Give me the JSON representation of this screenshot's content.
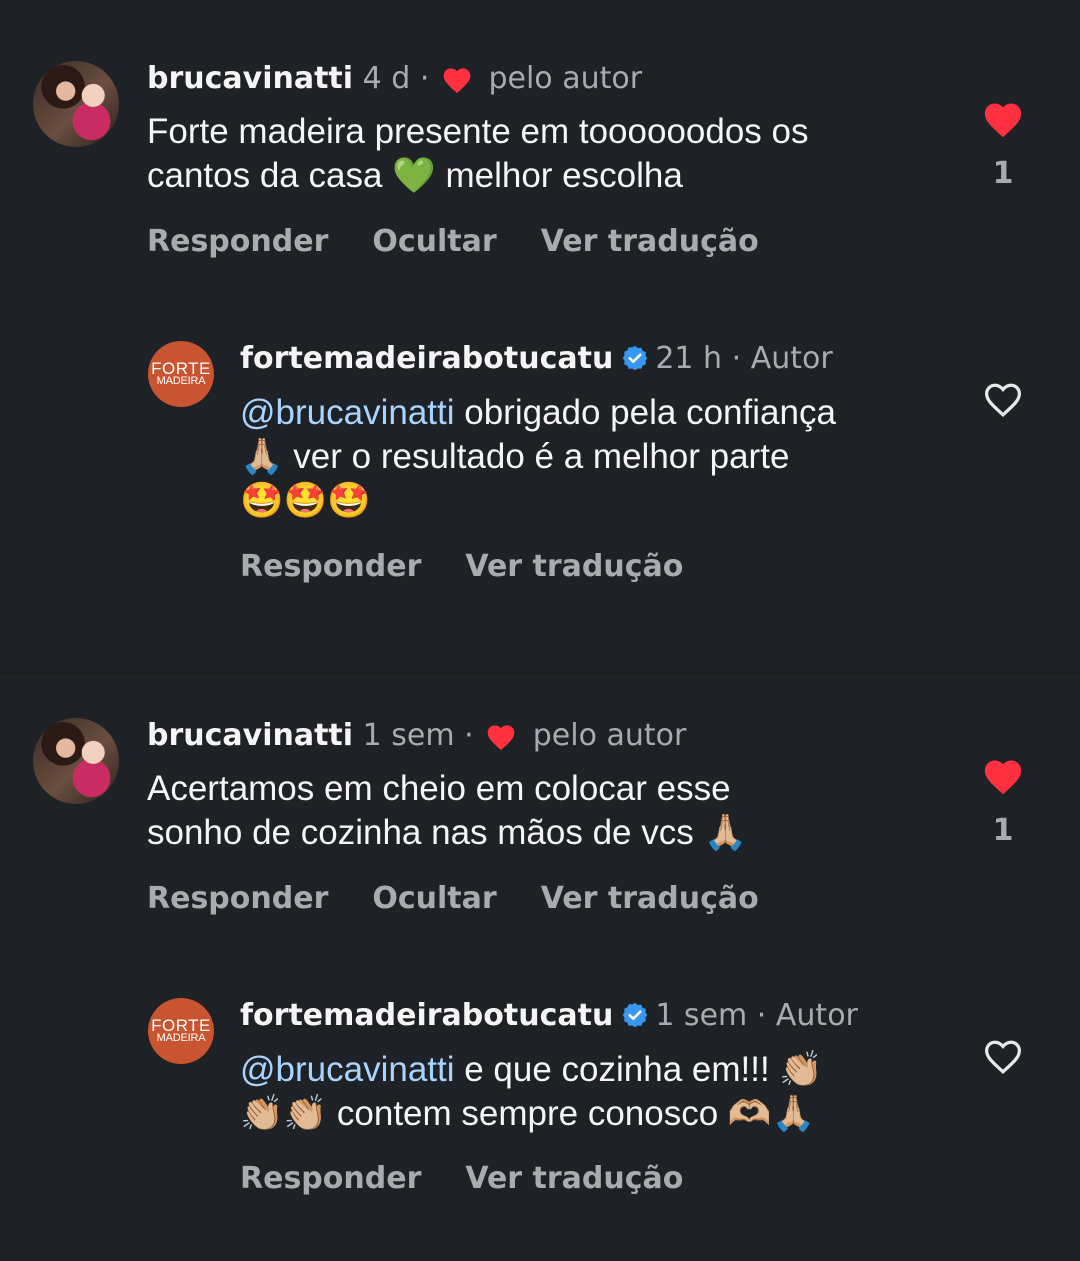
{
  "comments": [
    {
      "username": "brucavinatti",
      "time": "4 d",
      "sep": "·",
      "liked_by_author_label": "pelo autor",
      "text": "Forte madeira presente em toooooodos os\ncantos da casa 💚 melhor escolha",
      "actions": [
        "Responder",
        "Ocultar",
        "Ver tradução"
      ],
      "like_count": "1",
      "liked": true,
      "avatar": "user-photo"
    },
    {
      "username": "fortemadeirabotucatu",
      "time": "21 h",
      "sep": "·",
      "author_label": "Autor",
      "mention": "@brucavinatti",
      "text_after_mention": " obrigado pela confiança\n🙏🏼 ver o resultado é a melhor parte\n🤩🤩🤩",
      "actions": [
        "Responder",
        "Ver tradução"
      ],
      "liked": false,
      "avatar_text": [
        "FORTE",
        "MADEIRA"
      ],
      "verified": true
    },
    {
      "username": "brucavinatti",
      "time": "1 sem",
      "sep": "·",
      "liked_by_author_label": "pelo autor",
      "text": "Acertamos em cheio em colocar esse\nsonho de cozinha nas mãos de vcs 🙏🏼",
      "actions": [
        "Responder",
        "Ocultar",
        "Ver tradução"
      ],
      "like_count": "1",
      "liked": true,
      "avatar": "user-photo"
    },
    {
      "username": "fortemadeirabotucatu",
      "time": "1 sem",
      "sep": "·",
      "author_label": "Autor",
      "mention": "@brucavinatti",
      "text_after_mention": " e que cozinha em!!! 👏🏼\n👏🏼👏🏼 contem sempre conosco 🫶🏼🙏🏼",
      "actions": [
        "Responder",
        "Ver tradução"
      ],
      "liked": false,
      "avatar_text": [
        "FORTE",
        "MADEIRA"
      ],
      "verified": true
    }
  ],
  "colors": {
    "background": "#1e2125",
    "text": "#f5f5f5",
    "muted": "#a8abb0",
    "mention": "#a8d4ff",
    "like_red": "#ff3040",
    "verified_blue": "#3897f0",
    "brand_orange": "#c8552f"
  },
  "icons": {
    "liked": "heart-filled-icon",
    "unliked": "heart-outline-icon",
    "verified": "verified-badge-icon"
  }
}
